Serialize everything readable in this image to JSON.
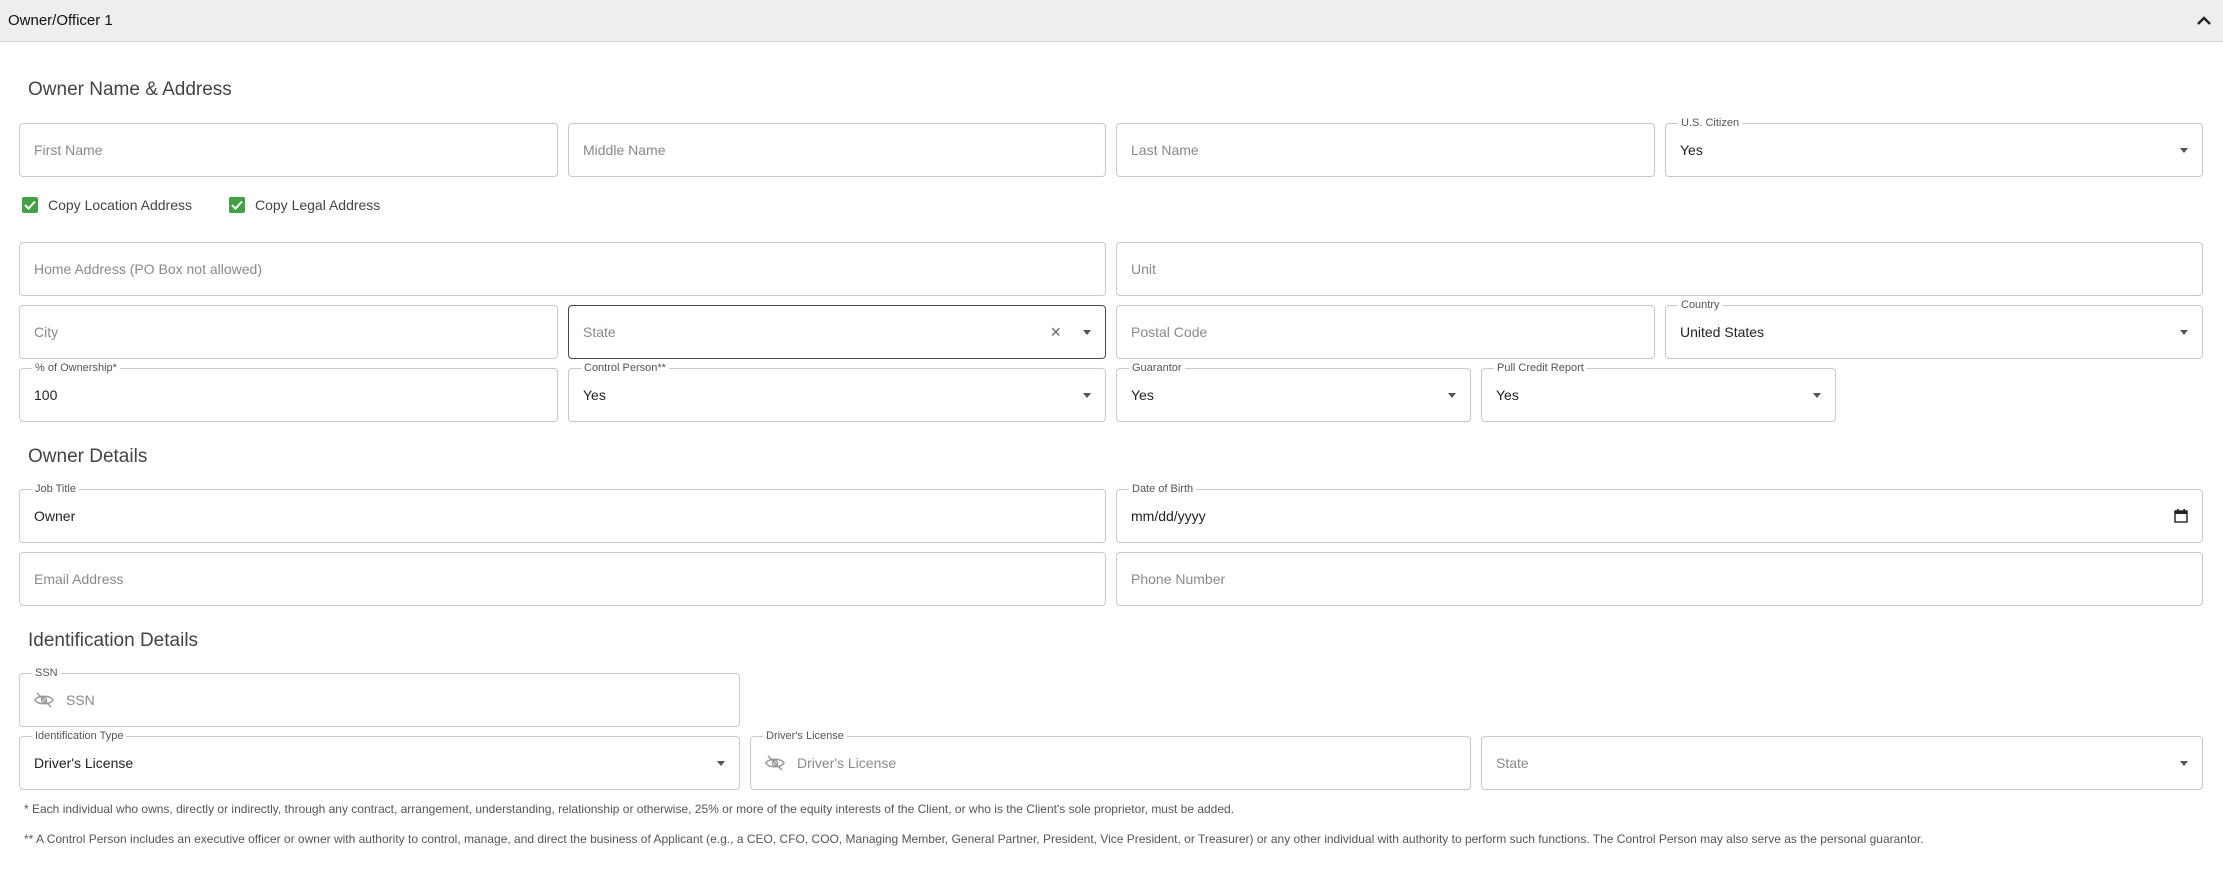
{
  "panel": {
    "title": "Owner/Officer 1"
  },
  "sections": {
    "owner_name_address": "Owner Name & Address",
    "owner_details": "Owner Details",
    "identification_details": "Identification Details"
  },
  "fields": {
    "first_name": {
      "placeholder": "First Name"
    },
    "middle_name": {
      "placeholder": "Middle Name"
    },
    "last_name": {
      "placeholder": "Last Name"
    },
    "us_citizen": {
      "label": "U.S. Citizen",
      "value": "Yes"
    },
    "home_address": {
      "placeholder": "Home Address (PO Box not allowed)"
    },
    "unit": {
      "placeholder": "Unit"
    },
    "city": {
      "placeholder": "City"
    },
    "state": {
      "placeholder": "State"
    },
    "postal_code": {
      "placeholder": "Postal Code"
    },
    "country": {
      "label": "Country",
      "value": "United States"
    },
    "ownership": {
      "label": "% of Ownership*",
      "value": "100"
    },
    "control_person": {
      "label": "Control Person**",
      "value": "Yes"
    },
    "guarantor": {
      "label": "Guarantor",
      "value": "Yes"
    },
    "pull_credit": {
      "label": "Pull Credit Report",
      "value": "Yes"
    },
    "job_title": {
      "label": "Job Title",
      "value": "Owner"
    },
    "dob": {
      "label": "Date of Birth",
      "value": "mm/dd/yyyy"
    },
    "email": {
      "placeholder": "Email Address"
    },
    "phone": {
      "placeholder": "Phone Number"
    },
    "ssn": {
      "label": "SSN",
      "placeholder": "SSN"
    },
    "id_type": {
      "label": "Identification Type",
      "value": "Driver's License"
    },
    "drivers_license": {
      "label": "Driver's License",
      "placeholder": "Driver's License"
    },
    "id_state": {
      "placeholder": "State"
    }
  },
  "checkboxes": {
    "copy_location": {
      "label": "Copy Location Address",
      "checked": true
    },
    "copy_legal": {
      "label": "Copy Legal Address",
      "checked": true
    }
  },
  "footnotes": {
    "ownership_note": "* Each individual who owns, directly or indirectly, through any contract, arrangement, understanding, relationship or otherwise, 25% or more of the equity interests of the Client, or who is the Client's sole proprietor, must be added.",
    "control_note": "** A Control Person includes an executive officer or owner with authority to control, manage, and direct the business of Applicant (e.g., a CEO, CFO, COO, Managing Member, General Partner, President, Vice President, or Treasurer) or any other individual with authority to perform such functions. The Control Person may also serve as the personal guarantor."
  },
  "icons": {
    "collapse": "chevron-up-icon",
    "dropdown": "caret-down-icon",
    "clear": "close-icon",
    "visibility": "eye-off-icon",
    "calendar": "calendar-icon",
    "checkbox": "check-icon"
  },
  "colors": {
    "accent": "#43a047",
    "border": "#c8c8c8",
    "header_bg": "#eeeeee"
  }
}
